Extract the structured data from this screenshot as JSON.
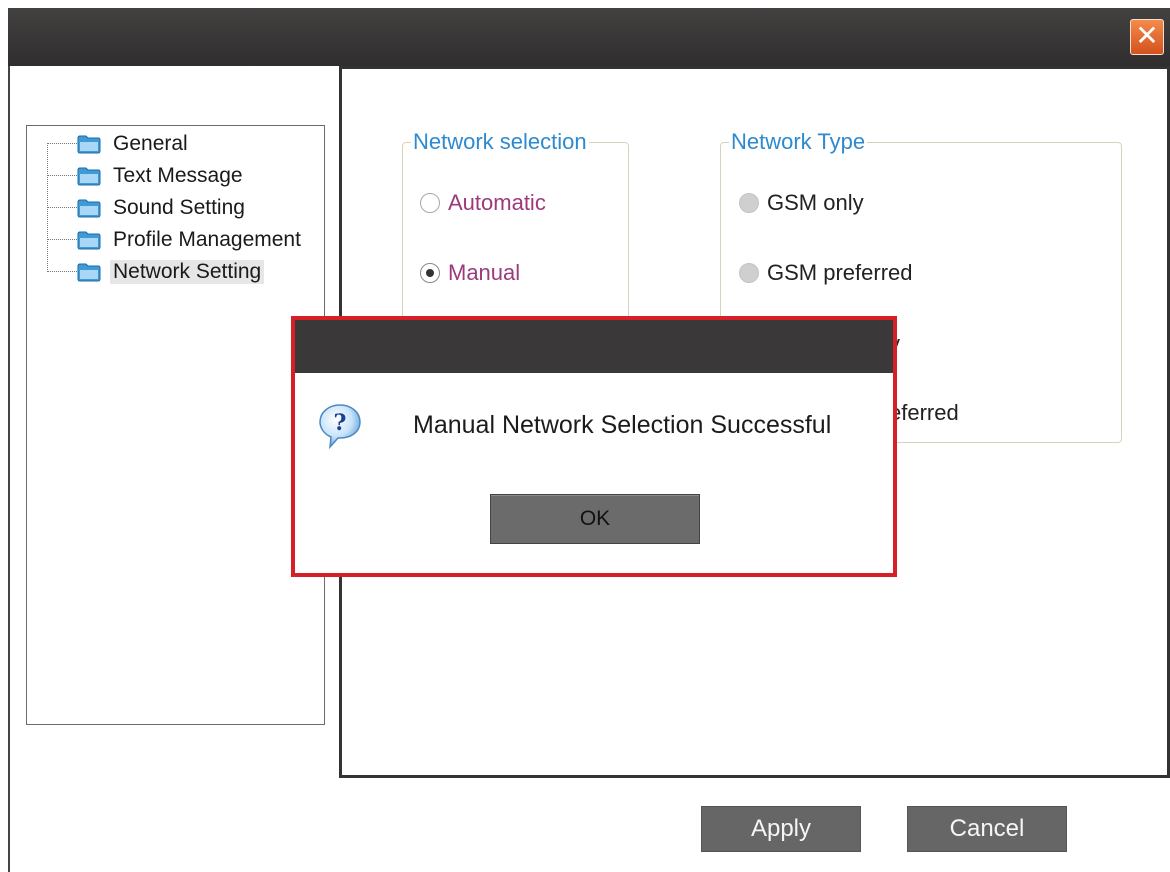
{
  "window": {
    "close_glyph": "✕"
  },
  "tree": {
    "items": [
      {
        "label": "General",
        "icon": "folder-icon",
        "selected": false
      },
      {
        "label": "Text Message",
        "icon": "folder-icon",
        "selected": false
      },
      {
        "label": "Sound Setting",
        "icon": "folder-icon",
        "selected": false
      },
      {
        "label": "Profile Management",
        "icon": "folder-icon",
        "selected": false
      },
      {
        "label": "Network Setting",
        "icon": "folder-icon",
        "selected": true
      }
    ]
  },
  "network_selection": {
    "legend": "Network selection",
    "options": [
      {
        "label": "Automatic",
        "state": "unchecked"
      },
      {
        "label": "Manual",
        "state": "checked"
      }
    ]
  },
  "network_type": {
    "legend": "Network Type",
    "options": [
      {
        "label": "GSM only",
        "state": "disabled"
      },
      {
        "label": "GSM preferred",
        "state": "disabled"
      }
    ],
    "partial_visible": [
      "y",
      "eferred"
    ]
  },
  "dialog": {
    "icon": "question-icon",
    "message": "Manual Network Selection Successful",
    "ok_label": "OK"
  },
  "footer": {
    "apply_label": "Apply",
    "cancel_label": "Cancel"
  },
  "colors": {
    "titlebar": "#3a3838",
    "close_button": "#e0642a",
    "legend_text": "#2d8ad0",
    "option_text": "#9c3a7c",
    "dialog_border": "#d71f27",
    "button_bg": "#666666"
  }
}
